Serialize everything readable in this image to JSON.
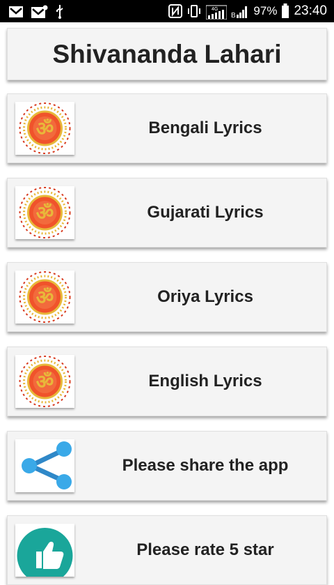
{
  "status_bar": {
    "battery": "97%",
    "time": "23:40",
    "network": "4G",
    "icons": [
      "mail-icon",
      "mail-icon",
      "usb-icon",
      "nfc-icon",
      "vibrate-icon",
      "signal-icon",
      "signal-icon",
      "battery-icon"
    ]
  },
  "app": {
    "title": "Shivananda Lahari"
  },
  "menu": {
    "items": [
      {
        "label": "Bengali Lyrics",
        "icon": "om-icon"
      },
      {
        "label": "Gujarati Lyrics",
        "icon": "om-icon"
      },
      {
        "label": "Oriya Lyrics",
        "icon": "om-icon"
      },
      {
        "label": "English Lyrics",
        "icon": "om-icon"
      },
      {
        "label": "Please share the app",
        "icon": "share-icon"
      },
      {
        "label": "Please rate 5 star",
        "icon": "thumbs-up-icon"
      }
    ]
  },
  "colors": {
    "om_orange": "#f0532b",
    "om_gold": "#e8b83a",
    "share_blue": "#3aa9e8",
    "rate_teal": "#1aa69a"
  }
}
